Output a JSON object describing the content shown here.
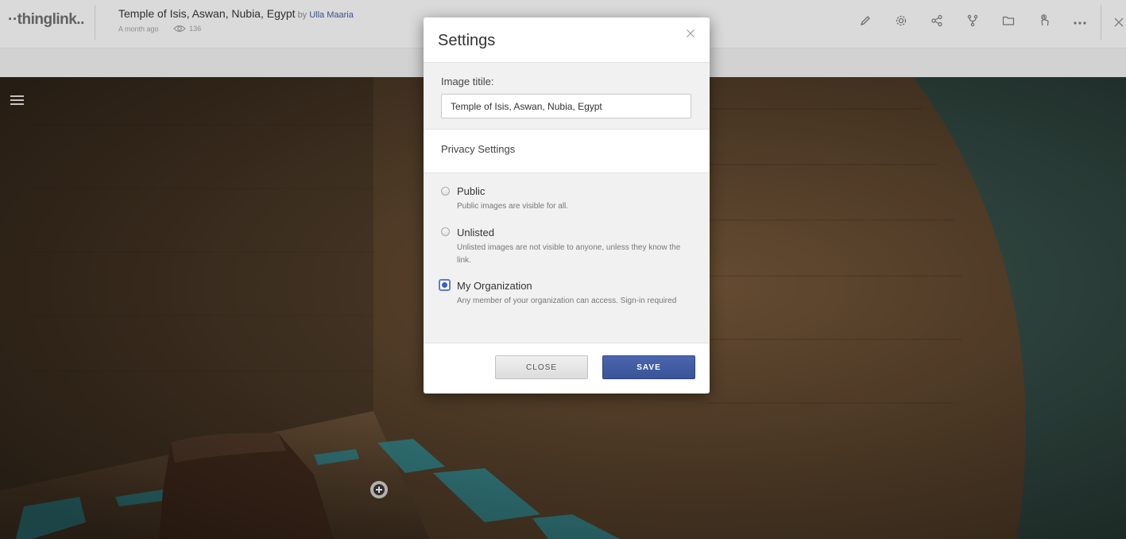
{
  "header": {
    "logo": "··thinglink..",
    "title": "Temple of Isis, Aswan, Nubia, Egypt",
    "by": "by",
    "author": "Ulla Maaria",
    "posted": "A month ago",
    "views": "136",
    "toolbar_icons": [
      "pencil-icon",
      "gear-icon",
      "share-icon",
      "fork-icon",
      "folder-icon",
      "touch-icon",
      "more-icon"
    ]
  },
  "modal": {
    "title": "Settings",
    "image_title_label": "Image titile:",
    "image_title_value": "Temple of Isis, Aswan, Nubia, Egypt",
    "privacy_heading": "Privacy Settings",
    "options": [
      {
        "label": "Public",
        "desc": "Public images are visible for all.",
        "selected": false
      },
      {
        "label": "Unlisted",
        "desc": "Unlisted images are not visible to anyone, unless they know the link.",
        "selected": false
      },
      {
        "label": "My Organization",
        "desc": "Any member of your organization can access. Sign-in required",
        "selected": true
      }
    ],
    "close_label": "CLOSE",
    "save_label": "SAVE"
  },
  "colors": {
    "accent": "#3a5398",
    "header_bg": "#ededed",
    "author_link": "#3b5998"
  }
}
